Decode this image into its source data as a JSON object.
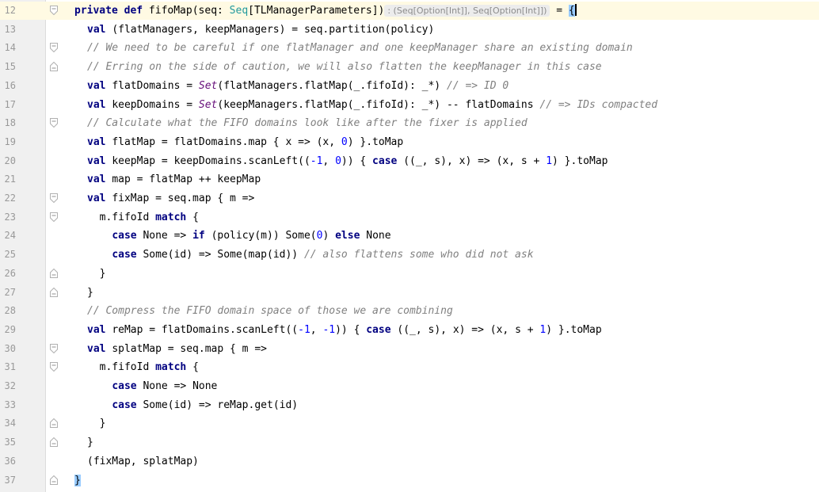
{
  "editor": {
    "lines": [
      {
        "num": "12",
        "tokens": [
          {
            "t": "kw",
            "v": "private def "
          },
          {
            "t": "n",
            "v": "fifoMap(seq: "
          },
          {
            "t": "ty",
            "v": "Seq"
          },
          {
            "t": "n",
            "v": "[TLManagerParameters])"
          }
        ],
        "hint": ": (Seq[Option[Int]], Seq[Option[Int]])",
        "tail": " = ",
        "brace": "{"
      },
      {
        "num": "13",
        "tokens": [
          {
            "t": "kw",
            "v": "val "
          },
          {
            "t": "n",
            "v": "(flatManagers, keepManagers) = seq.partition(policy)"
          }
        ]
      },
      {
        "num": "14",
        "tokens": [
          {
            "t": "cm",
            "v": "// We need to be careful if one flatManager and one keepManager share an existing domain"
          }
        ]
      },
      {
        "num": "15",
        "tokens": [
          {
            "t": "cm",
            "v": "// Erring on the side of caution, we will also flatten the keepManager in this case"
          }
        ]
      },
      {
        "num": "16",
        "tokens": [
          {
            "t": "kw",
            "v": "val "
          },
          {
            "t": "n",
            "v": "flatDomains = "
          },
          {
            "t": "st",
            "v": "Set"
          },
          {
            "t": "n",
            "v": "(flatManagers.flatMap(_.fifoId): _*) "
          },
          {
            "t": "cm",
            "v": "// => ID 0"
          }
        ]
      },
      {
        "num": "17",
        "tokens": [
          {
            "t": "kw",
            "v": "val "
          },
          {
            "t": "n",
            "v": "keepDomains = "
          },
          {
            "t": "st",
            "v": "Set"
          },
          {
            "t": "n",
            "v": "(keepManagers.flatMap(_.fifoId): _*) -- flatDomains "
          },
          {
            "t": "cm",
            "v": "// => IDs compacted"
          }
        ]
      },
      {
        "num": "18",
        "tokens": [
          {
            "t": "cm",
            "v": "// Calculate what the FIFO domains look like after the fixer is applied"
          }
        ]
      },
      {
        "num": "19",
        "tokens": [
          {
            "t": "kw",
            "v": "val "
          },
          {
            "t": "n",
            "v": "flatMap = flatDomains.map { x => (x, "
          },
          {
            "t": "num",
            "v": "0"
          },
          {
            "t": "n",
            "v": ") }.toMap"
          }
        ]
      },
      {
        "num": "20",
        "tokens": [
          {
            "t": "kw",
            "v": "val "
          },
          {
            "t": "n",
            "v": "keepMap = keepDomains.scanLeft(("
          },
          {
            "t": "num",
            "v": "-1"
          },
          {
            "t": "n",
            "v": ", "
          },
          {
            "t": "num",
            "v": "0"
          },
          {
            "t": "n",
            "v": ")) { "
          },
          {
            "t": "kw",
            "v": "case "
          },
          {
            "t": "n",
            "v": "((_, s), x) => (x, s + "
          },
          {
            "t": "num",
            "v": "1"
          },
          {
            "t": "n",
            "v": ") }.toMap"
          }
        ]
      },
      {
        "num": "21",
        "tokens": [
          {
            "t": "kw",
            "v": "val "
          },
          {
            "t": "n",
            "v": "map = flatMap ++ keepMap"
          }
        ]
      },
      {
        "num": "22",
        "tokens": [
          {
            "t": "kw",
            "v": "val "
          },
          {
            "t": "n",
            "v": "fixMap = seq.map { m =>"
          }
        ]
      },
      {
        "num": "23",
        "tokens": [
          {
            "t": "n",
            "v": "  m.fifoId "
          },
          {
            "t": "kw",
            "v": "match "
          },
          {
            "t": "n",
            "v": "{"
          }
        ]
      },
      {
        "num": "24",
        "tokens": [
          {
            "t": "n",
            "v": "    "
          },
          {
            "t": "kw",
            "v": "case "
          },
          {
            "t": "n",
            "v": "None => "
          },
          {
            "t": "kw",
            "v": "if "
          },
          {
            "t": "n",
            "v": "(policy(m)) Some("
          },
          {
            "t": "num",
            "v": "0"
          },
          {
            "t": "n",
            "v": ") "
          },
          {
            "t": "kw",
            "v": "else "
          },
          {
            "t": "n",
            "v": "None"
          }
        ]
      },
      {
        "num": "25",
        "tokens": [
          {
            "t": "n",
            "v": "    "
          },
          {
            "t": "kw",
            "v": "case "
          },
          {
            "t": "n",
            "v": "Some(id) => Some(map(id)) "
          },
          {
            "t": "cm",
            "v": "// also flattens some who did not ask"
          }
        ]
      },
      {
        "num": "26",
        "tokens": [
          {
            "t": "n",
            "v": "  }"
          }
        ]
      },
      {
        "num": "27",
        "tokens": [
          {
            "t": "n",
            "v": "}"
          }
        ]
      },
      {
        "num": "28",
        "tokens": [
          {
            "t": "cm",
            "v": "// Compress the FIFO domain space of those we are combining"
          }
        ]
      },
      {
        "num": "29",
        "tokens": [
          {
            "t": "kw",
            "v": "val "
          },
          {
            "t": "n",
            "v": "reMap = flatDomains.scanLeft(("
          },
          {
            "t": "num",
            "v": "-1"
          },
          {
            "t": "n",
            "v": ", "
          },
          {
            "t": "num",
            "v": "-1"
          },
          {
            "t": "n",
            "v": ")) { "
          },
          {
            "t": "kw",
            "v": "case "
          },
          {
            "t": "n",
            "v": "((_, s), x) => (x, s + "
          },
          {
            "t": "num",
            "v": "1"
          },
          {
            "t": "n",
            "v": ") }.toMap"
          }
        ]
      },
      {
        "num": "30",
        "tokens": [
          {
            "t": "kw",
            "v": "val "
          },
          {
            "t": "n",
            "v": "splatMap = seq.map { m =>"
          }
        ]
      },
      {
        "num": "31",
        "tokens": [
          {
            "t": "n",
            "v": "  m.fifoId "
          },
          {
            "t": "kw",
            "v": "match "
          },
          {
            "t": "n",
            "v": "{"
          }
        ]
      },
      {
        "num": "32",
        "tokens": [
          {
            "t": "n",
            "v": "    "
          },
          {
            "t": "kw",
            "v": "case "
          },
          {
            "t": "n",
            "v": "None => None"
          }
        ]
      },
      {
        "num": "33",
        "tokens": [
          {
            "t": "n",
            "v": "    "
          },
          {
            "t": "kw",
            "v": "case "
          },
          {
            "t": "n",
            "v": "Some(id) => reMap.get(id)"
          }
        ]
      },
      {
        "num": "34",
        "tokens": [
          {
            "t": "n",
            "v": "  }"
          }
        ]
      },
      {
        "num": "35",
        "tokens": [
          {
            "t": "n",
            "v": "}"
          }
        ]
      },
      {
        "num": "36",
        "tokens": [
          {
            "t": "n",
            "v": "(fixMap, splatMap)"
          }
        ]
      },
      {
        "num": "37",
        "tokens": [],
        "close_brace": "}"
      }
    ],
    "fold_markers": {
      "12": "open",
      "14": "open",
      "15": "close",
      "18": "open",
      "22": "open",
      "23": "open",
      "26": "close",
      "27": "close",
      "30": "open",
      "31": "open",
      "34": "close",
      "35": "close",
      "37": "close"
    }
  }
}
